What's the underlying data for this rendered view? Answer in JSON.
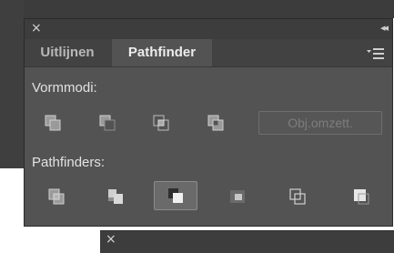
{
  "window": {
    "close_glyph": "×",
    "collapse_glyph": "◂◂"
  },
  "tabs": [
    {
      "label": "Uitlijnen",
      "active": false
    },
    {
      "label": "Pathfinder",
      "active": true
    }
  ],
  "shape_modes": {
    "label": "Vormmodi:",
    "buttons": [
      "unite-icon",
      "minus-front-icon",
      "intersect-icon",
      "exclude-icon"
    ],
    "expand_label": "Obj.omzett."
  },
  "pathfinders": {
    "label": "Pathfinders:",
    "buttons": [
      "divide-icon",
      "trim-icon",
      "merge-icon",
      "crop-icon",
      "outline-icon",
      "minus-back-icon"
    ],
    "selected": "merge-icon"
  },
  "second_panel": {
    "close_glyph": "×"
  },
  "colors": {
    "panel": "#535353",
    "titlebar": "#3d3d3d",
    "text": "#e2e2e2",
    "disabled": "#7d7d7d"
  }
}
